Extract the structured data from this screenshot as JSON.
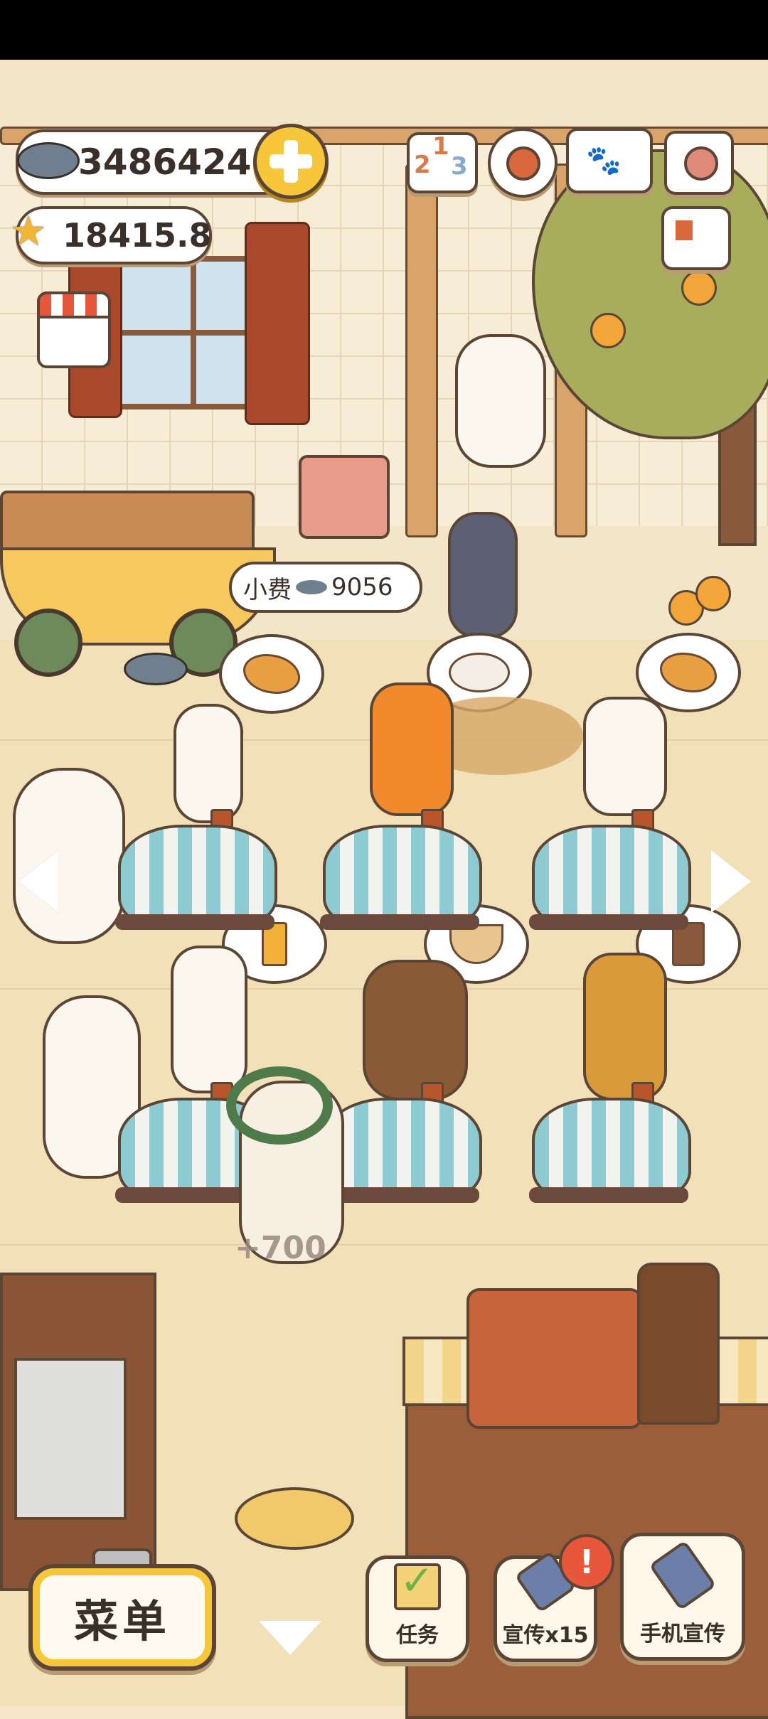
{
  "hud": {
    "fish_currency": "3486424",
    "star_currency": "18415.8",
    "fish_icon": "fish-icon",
    "star_icon": "star-icon",
    "add_icon": "plus-icon"
  },
  "top_icons": [
    "ranking-icon",
    "gear-icon",
    "paw-book-icon",
    "camera-icon",
    "newspaper-icon",
    "shop-icon"
  ],
  "rank_digits": {
    "first": "1",
    "second": "2",
    "third": "3"
  },
  "tip": {
    "label": "小费",
    "value": "9056"
  },
  "orders": [
    "taiyaki",
    "dumplings",
    "taiyaki",
    "orange-juice",
    "soup",
    "iced-coffee"
  ],
  "float_text": "+700",
  "bottom_bar": {
    "menu_label": "菜单",
    "task_label": "任务",
    "promo_label": "宣传x15",
    "phone_label": "手机宣传",
    "alert_badge": "!"
  },
  "colors": {
    "background": "#f5e7c8",
    "outline": "#5b4636",
    "accent_yellow": "#f7c63b",
    "table_stripe": "#8dcad2",
    "alert_red": "#e8573a"
  }
}
